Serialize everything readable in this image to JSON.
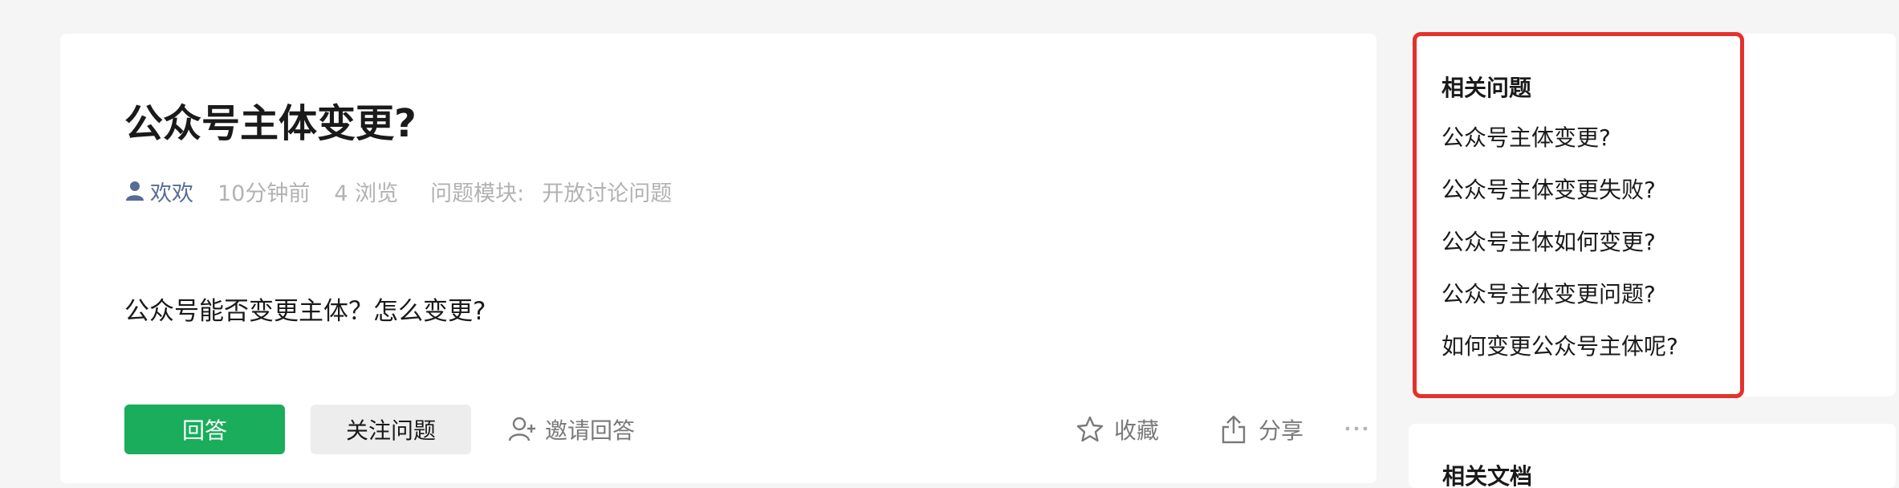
{
  "question": {
    "title": "公众号主体变更?",
    "author": "欢欢",
    "time": "10分钟前",
    "views": "4 浏览",
    "module_label": "问题模块:",
    "module_value": "开放讨论问题",
    "body": "公众号能否变更主体？怎么变更?"
  },
  "actions": {
    "answer": "回答",
    "follow": "关注问题",
    "invite": "邀请回答",
    "collect": "收藏",
    "share": "分享"
  },
  "related": {
    "title": "相关问题",
    "items": [
      "公众号主体变更?",
      "公众号主体变更失败?",
      "公众号主体如何变更?",
      "公众号主体变更问题?",
      "如何变更公众号主体呢?"
    ]
  },
  "related_docs": {
    "title": "相关文档"
  },
  "colors": {
    "accent_green": "#1aad5c",
    "author_link": "#576b95",
    "highlight_border": "#e4312b"
  },
  "icons": {
    "author": "user-icon",
    "invite": "invite-user-icon",
    "collect": "star-icon",
    "share": "share-icon",
    "more": "more-dots-icon"
  }
}
